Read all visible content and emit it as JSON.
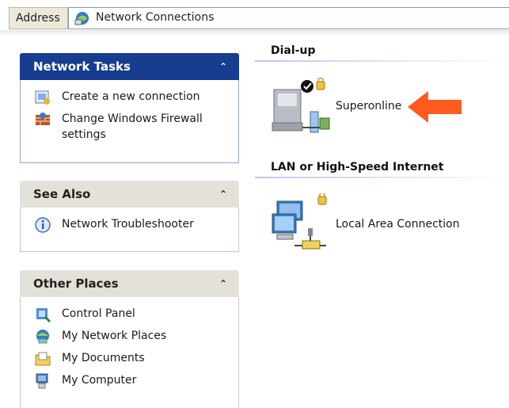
{
  "address_bar": {
    "label": "Address",
    "value": "Network Connections",
    "icon": "network-connections-icon"
  },
  "panes": {
    "network_tasks": {
      "title": "Network Tasks",
      "collapse_glyph": "⌃",
      "items": [
        {
          "label": "Create a new connection",
          "icon": "new-connection-icon"
        },
        {
          "label": "Change Windows Firewall settings",
          "icon": "firewall-icon"
        }
      ]
    },
    "see_also": {
      "title": "See Also",
      "collapse_glyph": "⌃",
      "items": [
        {
          "label": "Network Troubleshooter",
          "icon": "info-icon"
        }
      ]
    },
    "other_places": {
      "title": "Other Places",
      "collapse_glyph": "⌃",
      "items": [
        {
          "label": "Control Panel",
          "icon": "control-panel-icon"
        },
        {
          "label": "My Network Places",
          "icon": "network-places-icon"
        },
        {
          "label": "My Documents",
          "icon": "documents-folder-icon"
        },
        {
          "label": "My Computer",
          "icon": "computer-icon"
        }
      ]
    }
  },
  "groups": {
    "dialup": {
      "title": "Dial-up",
      "connection": {
        "label": "Superonline",
        "icon": "dialup-connection-icon"
      }
    },
    "lan": {
      "title": "LAN or High-Speed Internet",
      "connection": {
        "label": "Local Area Connection",
        "icon": "lan-connection-icon"
      }
    }
  },
  "annotation": {
    "arrow_color": "#ff5a1f"
  },
  "colors": {
    "pane_primary_header": "#163d8f",
    "pane_secondary_header": "#e3e1d8"
  }
}
